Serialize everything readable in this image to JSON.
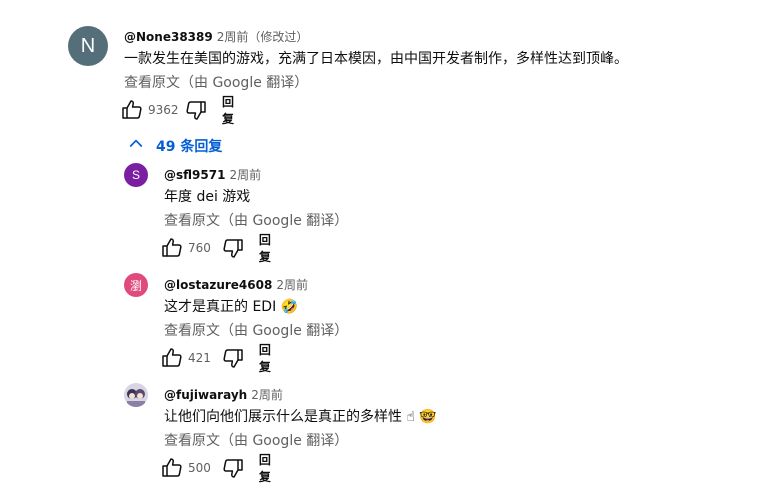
{
  "top": {
    "avatar_letter": "N",
    "avatar_color": "#546e7a",
    "handle": "@None38389",
    "time": "2周前（修改过）",
    "text": "一款发生在美国的游戏，充满了日本模因，由中国开发者制作，多样性达到顶峰。",
    "translate": "查看原文（由 Google 翻译）",
    "likes": "9362",
    "reply_label": "回复"
  },
  "replies_toggle": {
    "label": "49 条回复",
    "icon": "chevron-up-icon"
  },
  "replies": [
    {
      "avatar_letter": "S",
      "avatar_color": "#7b1fa2",
      "handle": "@sfl9571",
      "time": "2周前",
      "text": "年度 dei 游戏",
      "translate": "查看原文（由 Google 翻译）",
      "likes": "760",
      "reply_label": "回复"
    },
    {
      "avatar_letter": "瀏",
      "avatar_color": "#e04a7c",
      "handle": "@lostazure4608",
      "time": "2周前",
      "text": "这才是真正的 EDI 🤣",
      "translate": "查看原文（由 Google 翻译）",
      "likes": "421",
      "reply_label": "回复"
    },
    {
      "avatar_letter": "",
      "avatar_color": "#d9d4e6",
      "handle": "@fujiwarayh",
      "time": "2周前",
      "text": "让他们向他们展示什么是真正的多样性 ☝ 🤓",
      "translate": "查看原文（由 Google 翻译）",
      "likes": "500",
      "reply_label": "回复"
    }
  ]
}
